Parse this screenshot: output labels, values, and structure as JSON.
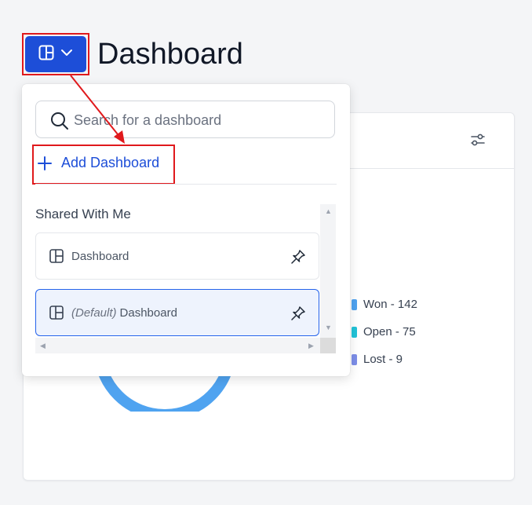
{
  "page": {
    "title": "Dashboard"
  },
  "header": {
    "menu_icon": "dashboard-grid-icon",
    "toggle_icon": "chevron-down-icon"
  },
  "dropdown": {
    "search_placeholder": "Search for a dashboard",
    "add_label": "Add Dashboard",
    "section_label": "Shared With Me",
    "items": [
      {
        "prefix": "",
        "label": "Dashboard",
        "selected": false
      },
      {
        "prefix": "(Default)",
        "label": "Dashboard",
        "selected": true
      }
    ]
  },
  "card": {
    "legend": [
      {
        "label": "Won - 142",
        "color": "#4fa3f0"
      },
      {
        "label": "Open - 75",
        "color": "#22c3d8"
      },
      {
        "label": "Lost - 9",
        "color": "#7c8ee8"
      }
    ]
  },
  "colors": {
    "primary": "#1d4ed8",
    "annotation": "#e0191c"
  }
}
